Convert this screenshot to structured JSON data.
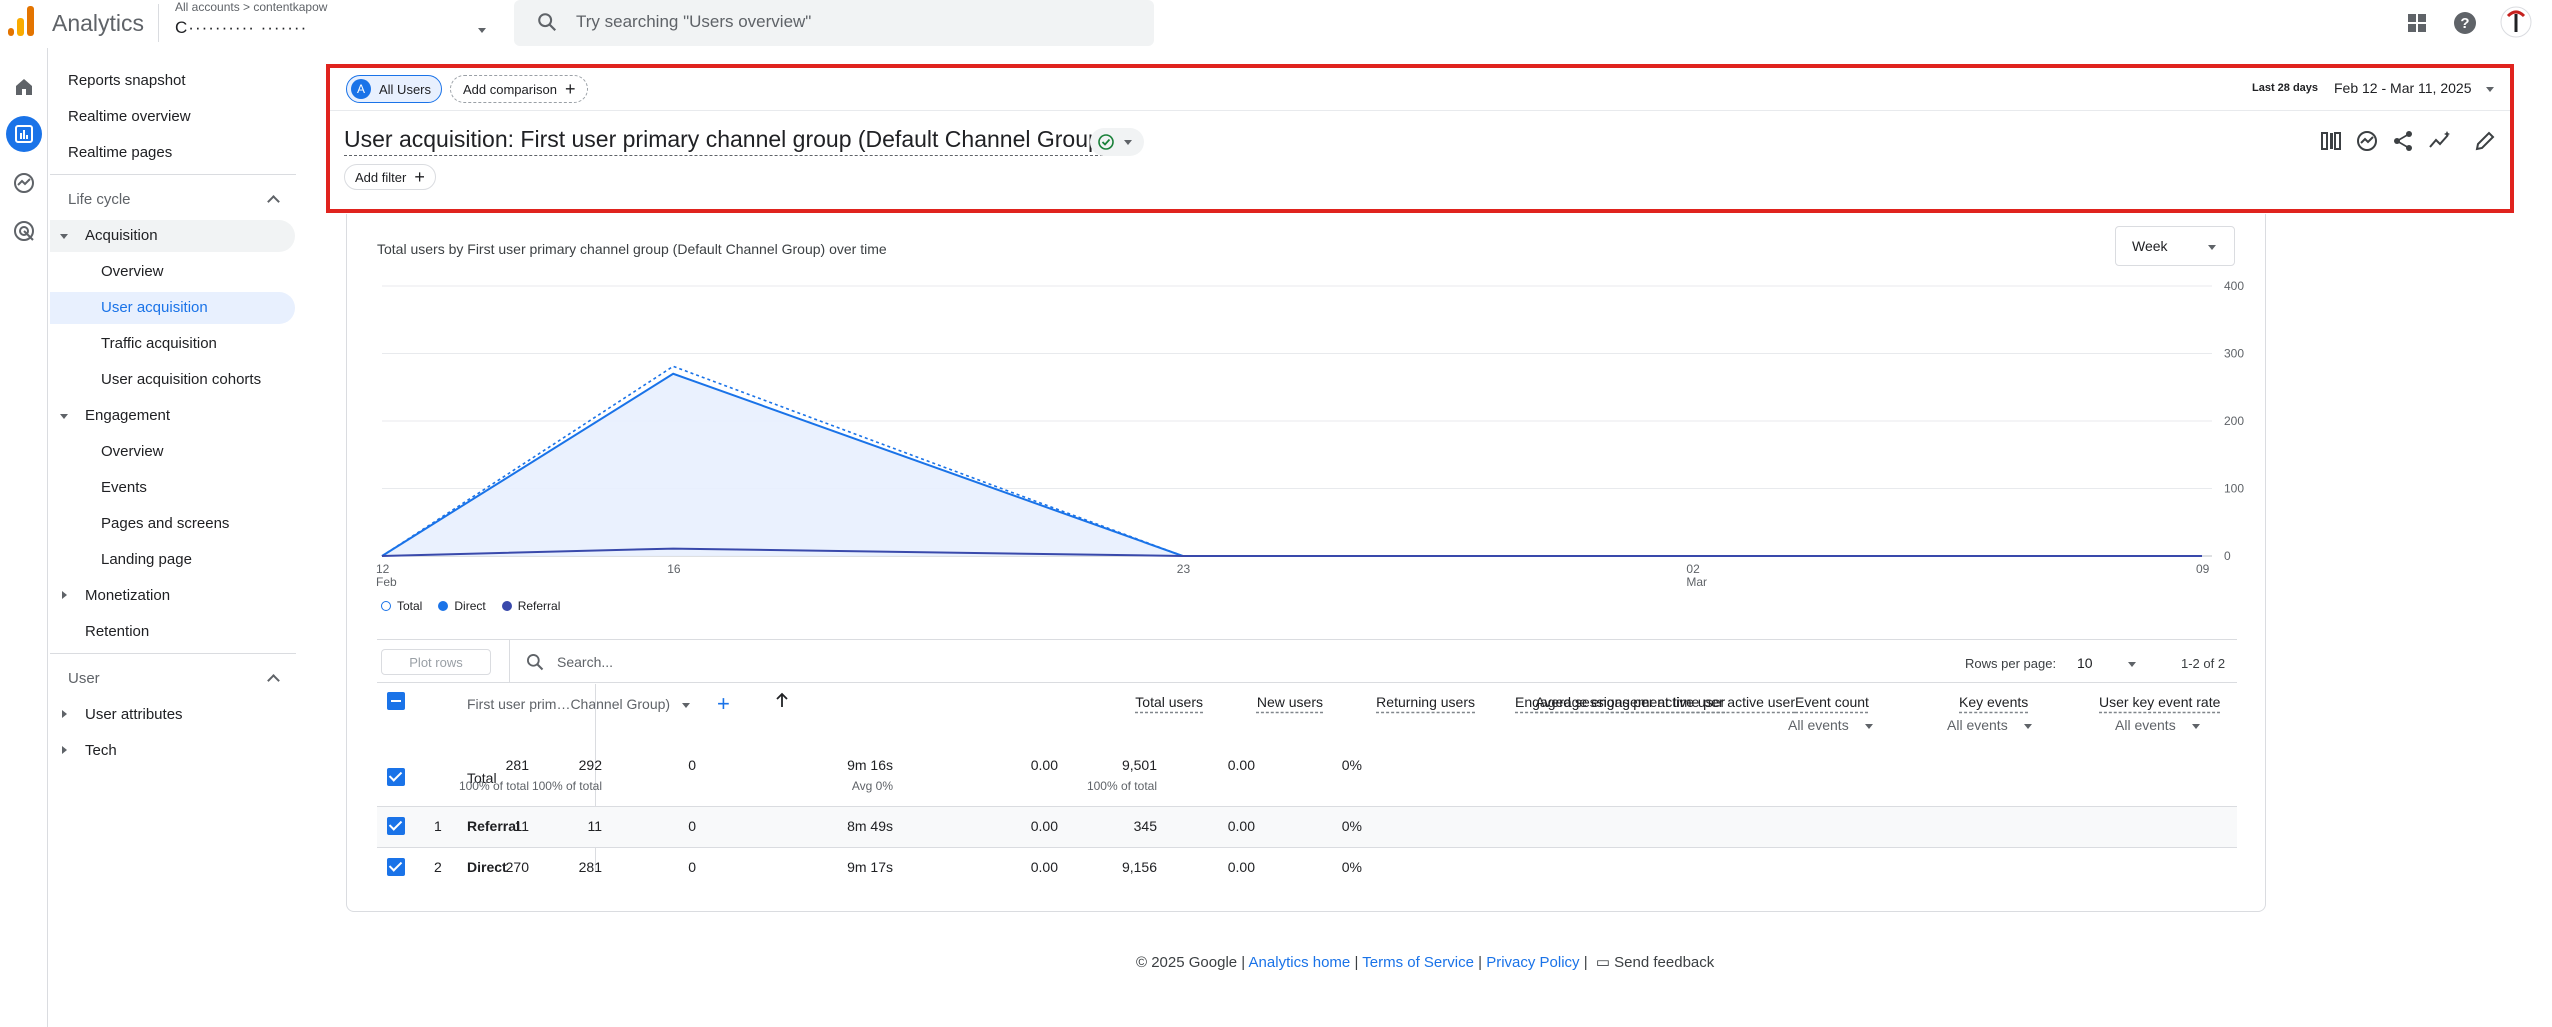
{
  "app": {
    "name": "Analytics",
    "breadcrumb": "All accounts > contentkapow",
    "account": "C·········· ·······"
  },
  "search": {
    "placeholder": "Try searching \"Users overview\""
  },
  "sidebar": {
    "top": [
      "Reports snapshot",
      "Realtime overview",
      "Realtime pages"
    ],
    "lifecycle": "Life cycle",
    "acquisition": "Acquisition",
    "acquisition_items": [
      "Overview",
      "User acquisition",
      "Traffic acquisition",
      "User acquisition cohorts"
    ],
    "engagement": "Engagement",
    "engagement_items": [
      "Overview",
      "Events",
      "Pages and screens",
      "Landing page"
    ],
    "monetization": "Monetization",
    "retention": "Retention",
    "user_section": "User",
    "user_attributes": "User attributes",
    "tech": "Tech"
  },
  "header": {
    "segment_letter": "A",
    "segment": "All Users",
    "add_comparison": "Add comparison",
    "date_label": "Last 28 days",
    "date_range": "Feb 12 - Mar 11, 2025",
    "title": "User acquisition: First user primary channel group (Default Channel Group)",
    "add_filter": "Add filter"
  },
  "chart_data": {
    "type": "line",
    "title": "Total users by First user primary channel group (Default Channel Group) over time",
    "interval": "Week",
    "x": [
      "12 Feb",
      "16",
      "23",
      "02 Mar",
      "09"
    ],
    "x_ticks": [
      {
        "day": "12",
        "month": "Feb"
      },
      {
        "day": "16",
        "month": ""
      },
      {
        "day": "23",
        "month": ""
      },
      {
        "day": "02",
        "month": "Mar"
      },
      {
        "day": "09",
        "month": ""
      }
    ],
    "x_positions_days": [
      0,
      4,
      11,
      18,
      25
    ],
    "y_ticks": [
      "400",
      "300",
      "200",
      "100",
      "0"
    ],
    "ylim": [
      0,
      400
    ],
    "series": [
      {
        "name": "Total",
        "points": [
          [
            0,
            0
          ],
          [
            4,
            281
          ],
          [
            11,
            0
          ],
          [
            18,
            0
          ],
          [
            25,
            0
          ]
        ],
        "color": "#1a73e8"
      },
      {
        "name": "Direct",
        "points": [
          [
            0,
            0
          ],
          [
            4,
            270
          ],
          [
            11,
            0
          ],
          [
            18,
            0
          ],
          [
            25,
            0
          ]
        ],
        "color": "#1a73e8"
      },
      {
        "name": "Referral",
        "points": [
          [
            0,
            0
          ],
          [
            4,
            11
          ],
          [
            11,
            0
          ],
          [
            18,
            0
          ],
          [
            25,
            0
          ]
        ],
        "color": "#3949ab"
      }
    ],
    "legend": [
      "Total",
      "Direct",
      "Referral"
    ]
  },
  "table": {
    "plot_rows": "Plot rows",
    "search_placeholder": "Search...",
    "rows_per_page_label": "Rows per page:",
    "rows_per_page": "10",
    "pagination": "1-2 of 2",
    "dimension_header": "First user prim…Channel Group)",
    "columns": [
      "Total users",
      "New users",
      "Returning users",
      "Average engagement time per active user",
      "Engaged sessions per active user",
      "Event count",
      "Key events",
      "User key event rate"
    ],
    "all_events": "All events",
    "total": {
      "label": "Total",
      "values": [
        "281",
        "292",
        "0",
        "9m 16s",
        "0.00",
        "9,501",
        "0.00",
        "0%"
      ],
      "subs": [
        "100% of total",
        "100% of total",
        "",
        "Avg 0%",
        "",
        "100% of total",
        "",
        ""
      ]
    },
    "rows": [
      {
        "index": "1",
        "name": "Referral",
        "values": [
          "11",
          "11",
          "0",
          "8m 49s",
          "0.00",
          "345",
          "0.00",
          "0%"
        ]
      },
      {
        "index": "2",
        "name": "Direct",
        "values": [
          "270",
          "281",
          "0",
          "9m 17s",
          "0.00",
          "9,156",
          "0.00",
          "0%"
        ]
      }
    ]
  },
  "footer": {
    "copyright": "© 2025 Google |",
    "analytics_home": "Analytics home",
    "sep1": "|",
    "terms": "Terms of Service",
    "sep2": "|",
    "privacy": "Privacy Policy",
    "sep3": "|",
    "feedback": "Send feedback"
  }
}
